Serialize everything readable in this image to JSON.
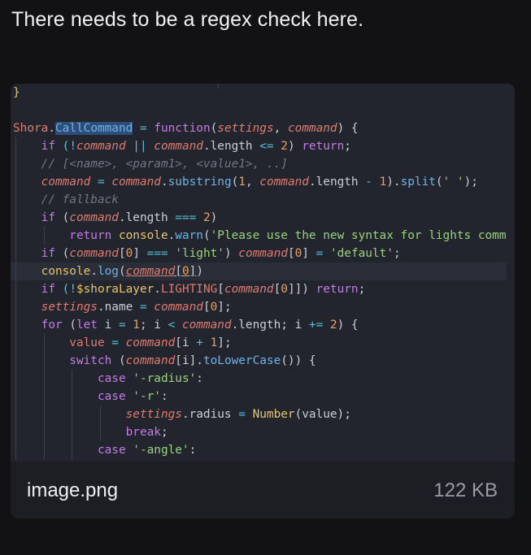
{
  "message": {
    "text": "There needs to be a regex check here."
  },
  "attachment": {
    "file_name": "image.png",
    "file_size": "122 KB",
    "overlay_text": "callCommand",
    "code_lines": [
      [
        {
          "t": "}",
          "c": "c-brace"
        }
      ],
      [],
      [
        {
          "t": "Shora",
          "c": "c-id"
        },
        {
          "t": ".",
          "c": "c-plain"
        },
        {
          "t": "CallCommand",
          "c": "c-sel"
        },
        {
          "t": " = ",
          "c": "c-op"
        },
        {
          "t": "function",
          "c": "c-kw"
        },
        {
          "t": "(",
          "c": "c-plain"
        },
        {
          "t": "settings",
          "c": "c-par"
        },
        {
          "t": ", ",
          "c": "c-plain"
        },
        {
          "t": "command",
          "c": "c-par"
        },
        {
          "t": ") {",
          "c": "c-plain"
        }
      ],
      [
        {
          "t": "    if ",
          "c": "c-kw"
        },
        {
          "t": "(!",
          "c": "c-op"
        },
        {
          "t": "command",
          "c": "c-par"
        },
        {
          "t": " || ",
          "c": "c-op"
        },
        {
          "t": "command",
          "c": "c-par"
        },
        {
          "t": ".length ",
          "c": "c-plain"
        },
        {
          "t": "<= ",
          "c": "c-op"
        },
        {
          "t": "2",
          "c": "c-num"
        },
        {
          "t": ") ",
          "c": "c-plain"
        },
        {
          "t": "return",
          "c": "c-kw"
        },
        {
          "t": ";",
          "c": "c-plain"
        }
      ],
      [
        {
          "t": "    // [<name>, <param1>, <value1>, ..]",
          "c": "c-cm"
        }
      ],
      [
        {
          "t": "    command",
          "c": "c-par"
        },
        {
          "t": " = ",
          "c": "c-op"
        },
        {
          "t": "command",
          "c": "c-par"
        },
        {
          "t": ".",
          "c": "c-plain"
        },
        {
          "t": "substring",
          "c": "c-fn"
        },
        {
          "t": "(",
          "c": "c-plain"
        },
        {
          "t": "1",
          "c": "c-num"
        },
        {
          "t": ", ",
          "c": "c-plain"
        },
        {
          "t": "command",
          "c": "c-par"
        },
        {
          "t": ".length ",
          "c": "c-plain"
        },
        {
          "t": "- ",
          "c": "c-op"
        },
        {
          "t": "1",
          "c": "c-num"
        },
        {
          "t": ").",
          "c": "c-plain"
        },
        {
          "t": "split",
          "c": "c-fn"
        },
        {
          "t": "(",
          "c": "c-plain"
        },
        {
          "t": "' '",
          "c": "c-str"
        },
        {
          "t": ");",
          "c": "c-plain"
        }
      ],
      [
        {
          "t": "    // fallback",
          "c": "c-cm"
        }
      ],
      [
        {
          "t": "    if ",
          "c": "c-kw"
        },
        {
          "t": "(",
          "c": "c-plain"
        },
        {
          "t": "command",
          "c": "c-par"
        },
        {
          "t": ".length ",
          "c": "c-plain"
        },
        {
          "t": "=== ",
          "c": "c-op"
        },
        {
          "t": "2",
          "c": "c-num"
        },
        {
          "t": ")",
          "c": "c-plain"
        }
      ],
      [
        {
          "t": "        return ",
          "c": "c-kw"
        },
        {
          "t": "console",
          "c": "c-y"
        },
        {
          "t": ".",
          "c": "c-plain"
        },
        {
          "t": "warn",
          "c": "c-fn"
        },
        {
          "t": "(",
          "c": "c-plain"
        },
        {
          "t": "'Please use the new syntax for lights comm",
          "c": "c-str"
        }
      ],
      [
        {
          "t": "    if ",
          "c": "c-kw"
        },
        {
          "t": "(",
          "c": "c-plain"
        },
        {
          "t": "command",
          "c": "c-par"
        },
        {
          "t": "[",
          "c": "c-plain"
        },
        {
          "t": "0",
          "c": "c-num"
        },
        {
          "t": "] ",
          "c": "c-plain"
        },
        {
          "t": "=== ",
          "c": "c-op"
        },
        {
          "t": "'light'",
          "c": "c-str"
        },
        {
          "t": ") ",
          "c": "c-plain"
        },
        {
          "t": "command",
          "c": "c-par"
        },
        {
          "t": "[",
          "c": "c-plain"
        },
        {
          "t": "0",
          "c": "c-num"
        },
        {
          "t": "] ",
          "c": "c-plain"
        },
        {
          "t": "= ",
          "c": "c-op"
        },
        {
          "t": "'default'",
          "c": "c-str"
        },
        {
          "t": ";",
          "c": "c-plain"
        }
      ],
      [
        {
          "t": "    console",
          "c": "c-y"
        },
        {
          "t": ".",
          "c": "c-plain"
        },
        {
          "t": "log",
          "c": "c-fn"
        },
        {
          "t": "(",
          "c": "c-plain"
        },
        {
          "t": "command",
          "c": "c-par c-ul"
        },
        {
          "t": "[",
          "c": "c-plain c-ul"
        },
        {
          "t": "0",
          "c": "c-num c-ul"
        },
        {
          "t": "]",
          "c": "c-plain c-ul"
        },
        {
          "t": ")",
          "c": "c-plain"
        }
      ],
      [
        {
          "t": "    if ",
          "c": "c-kw"
        },
        {
          "t": "(!",
          "c": "c-op"
        },
        {
          "t": "$shoraLayer",
          "c": "c-y"
        },
        {
          "t": ".",
          "c": "c-plain"
        },
        {
          "t": "LIGHTING",
          "c": "c-id"
        },
        {
          "t": "[",
          "c": "c-plain"
        },
        {
          "t": "command",
          "c": "c-par"
        },
        {
          "t": "[",
          "c": "c-plain"
        },
        {
          "t": "0",
          "c": "c-num"
        },
        {
          "t": "]]) ",
          "c": "c-plain"
        },
        {
          "t": "return",
          "c": "c-kw"
        },
        {
          "t": ";",
          "c": "c-plain"
        }
      ],
      [
        {
          "t": "    settings",
          "c": "c-par"
        },
        {
          "t": ".name ",
          "c": "c-plain"
        },
        {
          "t": "= ",
          "c": "c-op"
        },
        {
          "t": "command",
          "c": "c-par"
        },
        {
          "t": "[",
          "c": "c-plain"
        },
        {
          "t": "0",
          "c": "c-num"
        },
        {
          "t": "];",
          "c": "c-plain"
        }
      ],
      [
        {
          "t": "    for ",
          "c": "c-kw"
        },
        {
          "t": "(",
          "c": "c-plain"
        },
        {
          "t": "let ",
          "c": "c-kw"
        },
        {
          "t": "i ",
          "c": "c-plain"
        },
        {
          "t": "= ",
          "c": "c-op"
        },
        {
          "t": "1",
          "c": "c-num"
        },
        {
          "t": "; i ",
          "c": "c-plain"
        },
        {
          "t": "< ",
          "c": "c-op"
        },
        {
          "t": "command",
          "c": "c-par"
        },
        {
          "t": ".length; i ",
          "c": "c-plain"
        },
        {
          "t": "+= ",
          "c": "c-op"
        },
        {
          "t": "2",
          "c": "c-num"
        },
        {
          "t": ") {",
          "c": "c-plain"
        }
      ],
      [
        {
          "t": "        value",
          "c": "c-id"
        },
        {
          "t": " = ",
          "c": "c-op"
        },
        {
          "t": "command",
          "c": "c-par"
        },
        {
          "t": "[i ",
          "c": "c-plain"
        },
        {
          "t": "+ ",
          "c": "c-op"
        },
        {
          "t": "1",
          "c": "c-num"
        },
        {
          "t": "];",
          "c": "c-plain"
        }
      ],
      [
        {
          "t": "        switch ",
          "c": "c-kw"
        },
        {
          "t": "(",
          "c": "c-plain"
        },
        {
          "t": "command",
          "c": "c-par"
        },
        {
          "t": "[i].",
          "c": "c-plain"
        },
        {
          "t": "toLowerCase",
          "c": "c-fn"
        },
        {
          "t": "()) {",
          "c": "c-plain"
        }
      ],
      [
        {
          "t": "            case ",
          "c": "c-kw"
        },
        {
          "t": "'-radius'",
          "c": "c-str"
        },
        {
          "t": ":",
          "c": "c-plain"
        }
      ],
      [
        {
          "t": "            case ",
          "c": "c-kw"
        },
        {
          "t": "'-r'",
          "c": "c-str"
        },
        {
          "t": ":",
          "c": "c-plain"
        }
      ],
      [
        {
          "t": "                settings",
          "c": "c-par"
        },
        {
          "t": ".radius ",
          "c": "c-plain"
        },
        {
          "t": "= ",
          "c": "c-op"
        },
        {
          "t": "Number",
          "c": "c-y"
        },
        {
          "t": "(value);",
          "c": "c-plain"
        }
      ],
      [
        {
          "t": "                break",
          "c": "c-kw"
        },
        {
          "t": ";",
          "c": "c-plain"
        }
      ],
      [
        {
          "t": "            case ",
          "c": "c-kw"
        },
        {
          "t": "'-angle'",
          "c": "c-str"
        },
        {
          "t": ":",
          "c": "c-plain"
        }
      ]
    ],
    "highlighted_line": 10
  }
}
